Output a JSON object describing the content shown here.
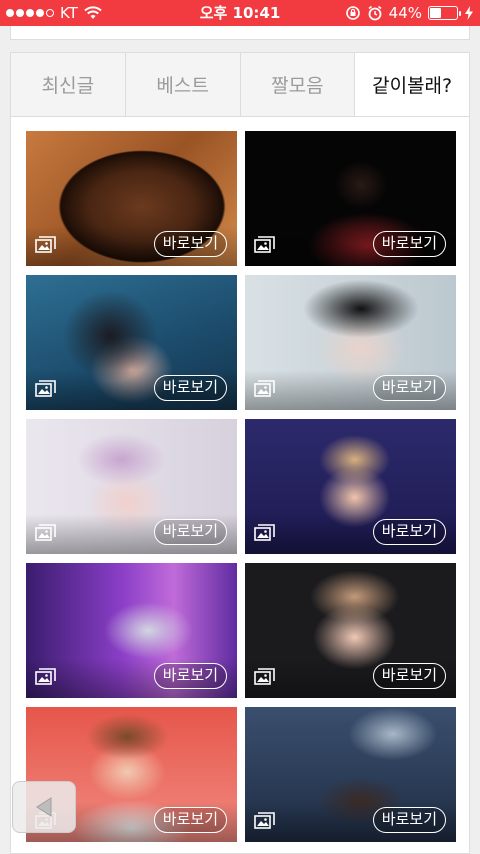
{
  "status_bar": {
    "carrier": "KT",
    "time": "오후 10:41",
    "battery_percent_text": "44%",
    "battery_level": 0.44
  },
  "tabs": [
    {
      "label": "최신글",
      "active": false
    },
    {
      "label": "베스트",
      "active": false
    },
    {
      "label": "짤모음",
      "active": false
    },
    {
      "label": "같이볼래?",
      "active": true
    }
  ],
  "tiles": [
    {
      "button_label": "바로보기"
    },
    {
      "button_label": "바로보기"
    },
    {
      "button_label": "바로보기"
    },
    {
      "button_label": "바로보기"
    },
    {
      "button_label": "바로보기"
    },
    {
      "button_label": "바로보기"
    },
    {
      "button_label": "바로보기"
    },
    {
      "button_label": "바로보기"
    },
    {
      "button_label": "바로보기"
    },
    {
      "button_label": "바로보기"
    }
  ],
  "colors": {
    "status_bar": "#f23b40",
    "active_tab_text": "#111111",
    "inactive_tab_text": "#9b9b9b"
  },
  "icons": {
    "image": "image-gallery-icon",
    "back": "back-arrow-icon",
    "wifi": "wifi-icon",
    "alarm": "alarm-icon",
    "rotation_lock": "rotation-lock-icon",
    "charging": "charging-bolt-icon"
  }
}
